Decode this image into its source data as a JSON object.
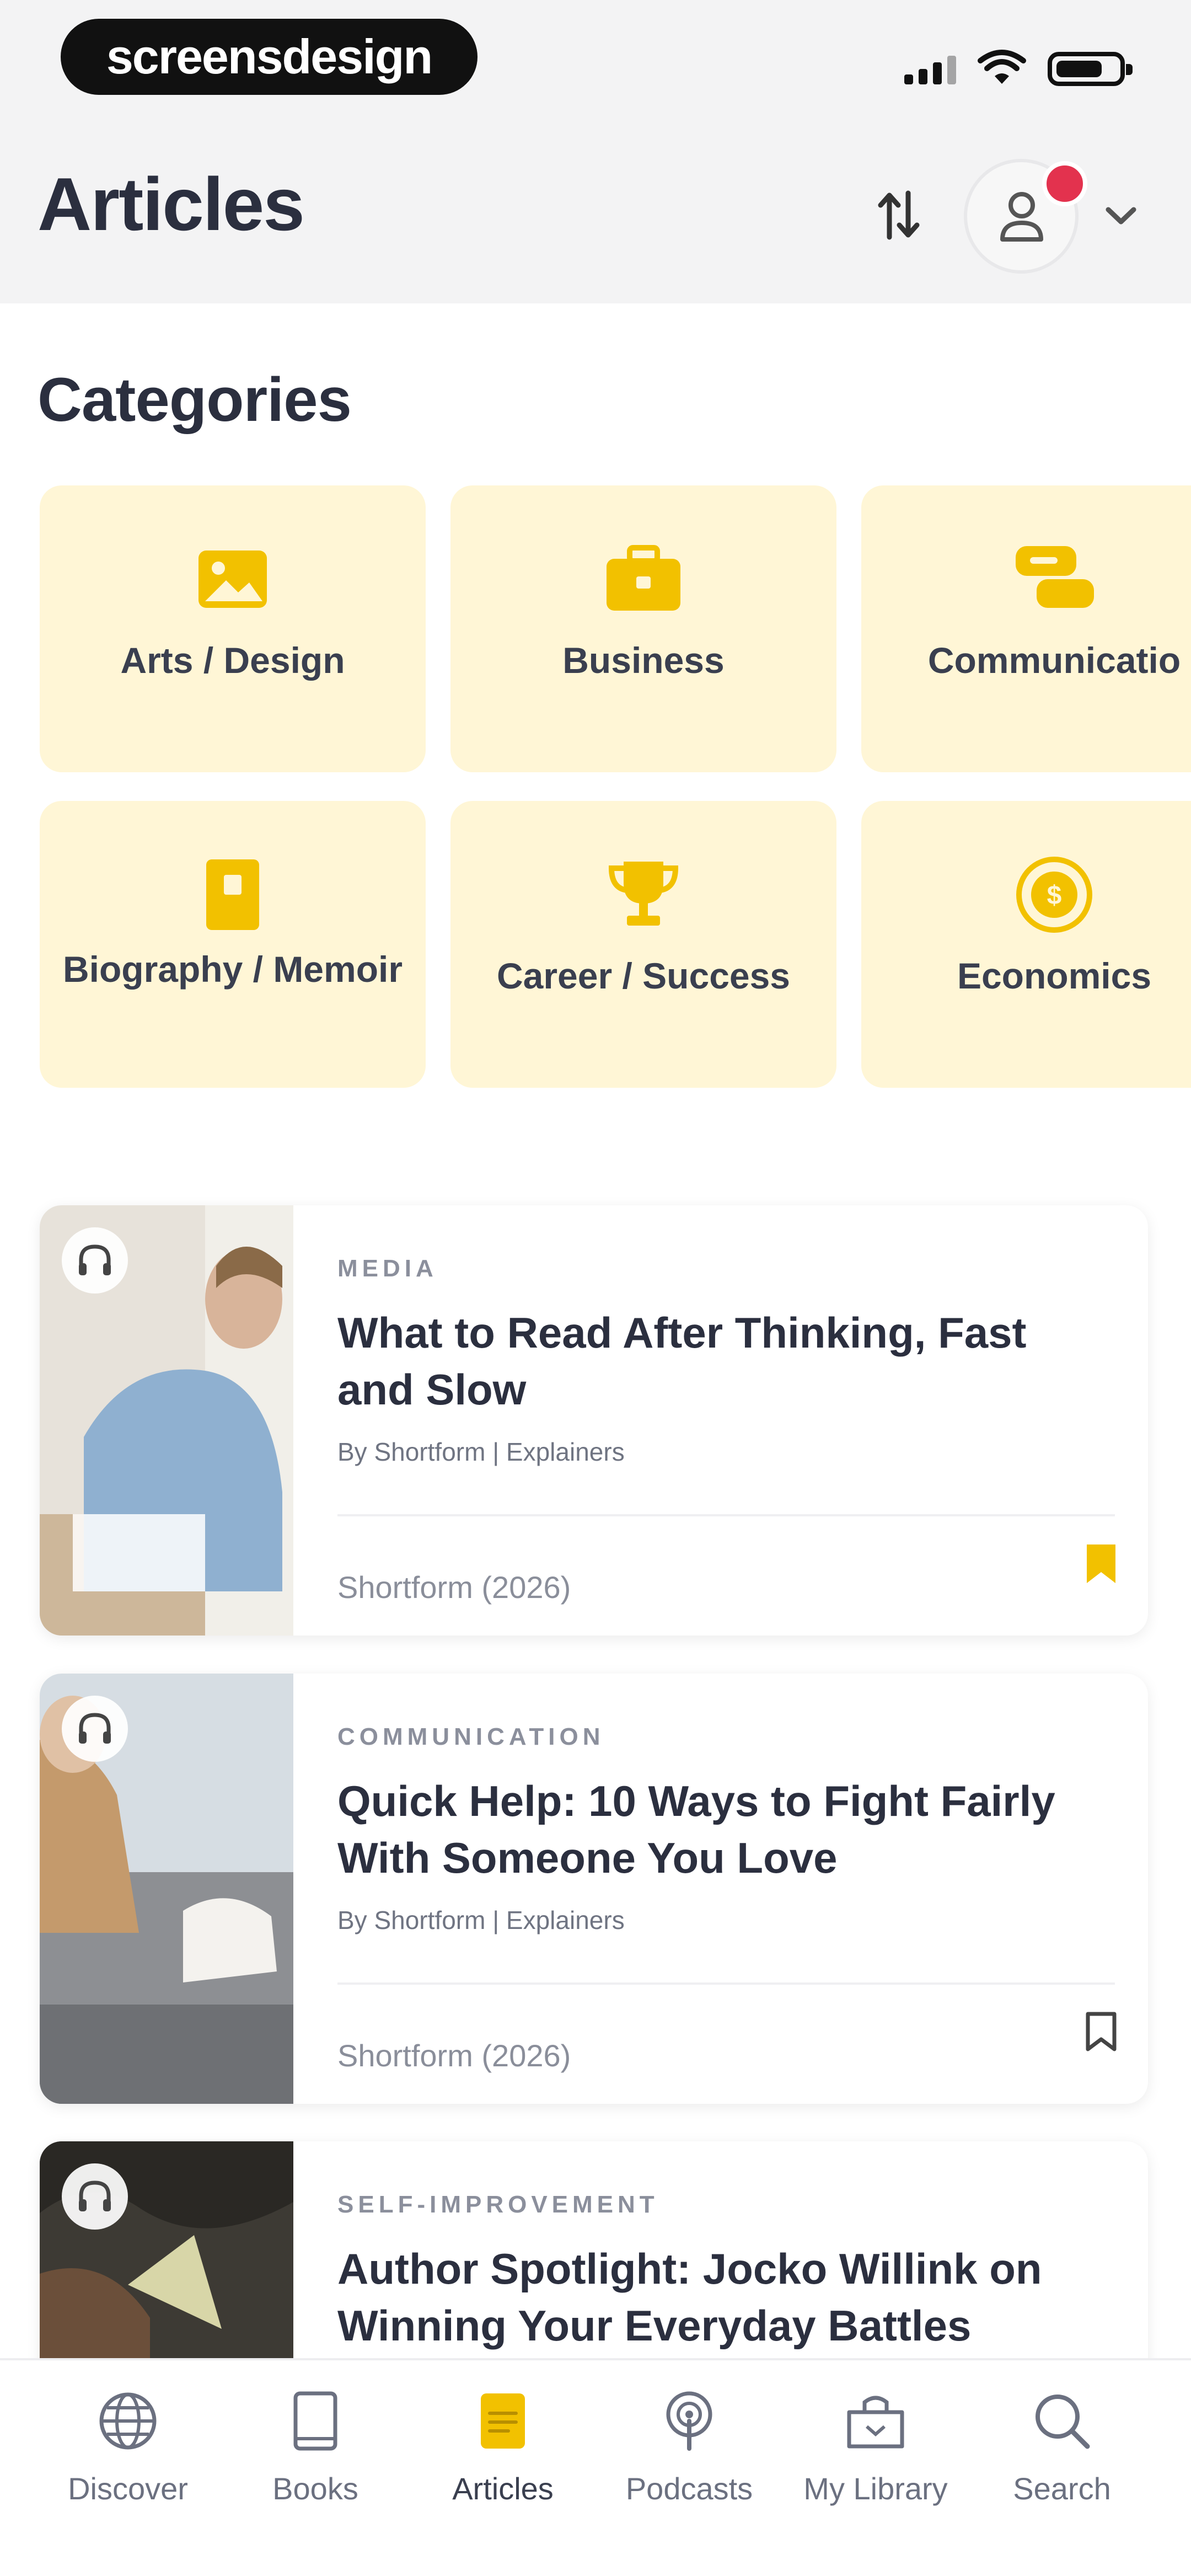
{
  "status_bar": {
    "brand_text": "screensdesign"
  },
  "header": {
    "title": "Articles"
  },
  "categories": {
    "title": "Categories",
    "items": [
      {
        "label": "Arts / Design",
        "icon": "image-icon"
      },
      {
        "label": "Business",
        "icon": "briefcase-icon"
      },
      {
        "label": "Communicatio",
        "icon": "chat-bubbles-icon"
      },
      {
        "label": "Biography / Memoir",
        "icon": "book-icon"
      },
      {
        "label": "Career / Success",
        "icon": "trophy-icon"
      },
      {
        "label": "Economics",
        "icon": "coin-icon"
      }
    ]
  },
  "articles": [
    {
      "category": "MEDIA",
      "title": "What to Read After Thinking, Fast and Slow",
      "byline": "By Shortform | Explainers",
      "source": "Shortform (2026)",
      "bookmarked": true
    },
    {
      "category": "COMMUNICATION",
      "title": "Quick Help: 10 Ways to Fight Fairly With Someone You Love",
      "byline": "By Shortform | Explainers",
      "source": "Shortform (2026)",
      "bookmarked": false
    },
    {
      "category": "SELF-IMPROVEMENT",
      "title": "Author Spotlight: Jocko Willink on Winning Your Everyday Battles",
      "byline": "",
      "source": "",
      "bookmarked": false
    }
  ],
  "nav": {
    "items": [
      {
        "label": "Discover",
        "icon": "globe-icon"
      },
      {
        "label": "Books",
        "icon": "book-outline-icon"
      },
      {
        "label": "Articles",
        "icon": "article-icon",
        "active": true
      },
      {
        "label": "Podcasts",
        "icon": "podcast-icon"
      },
      {
        "label": "My Library",
        "icon": "library-icon"
      },
      {
        "label": "Search",
        "icon": "search-icon"
      }
    ]
  },
  "colors": {
    "accent": "#F2C100",
    "tile_bg": "#FFF6D6",
    "badge": "#E3324E"
  }
}
